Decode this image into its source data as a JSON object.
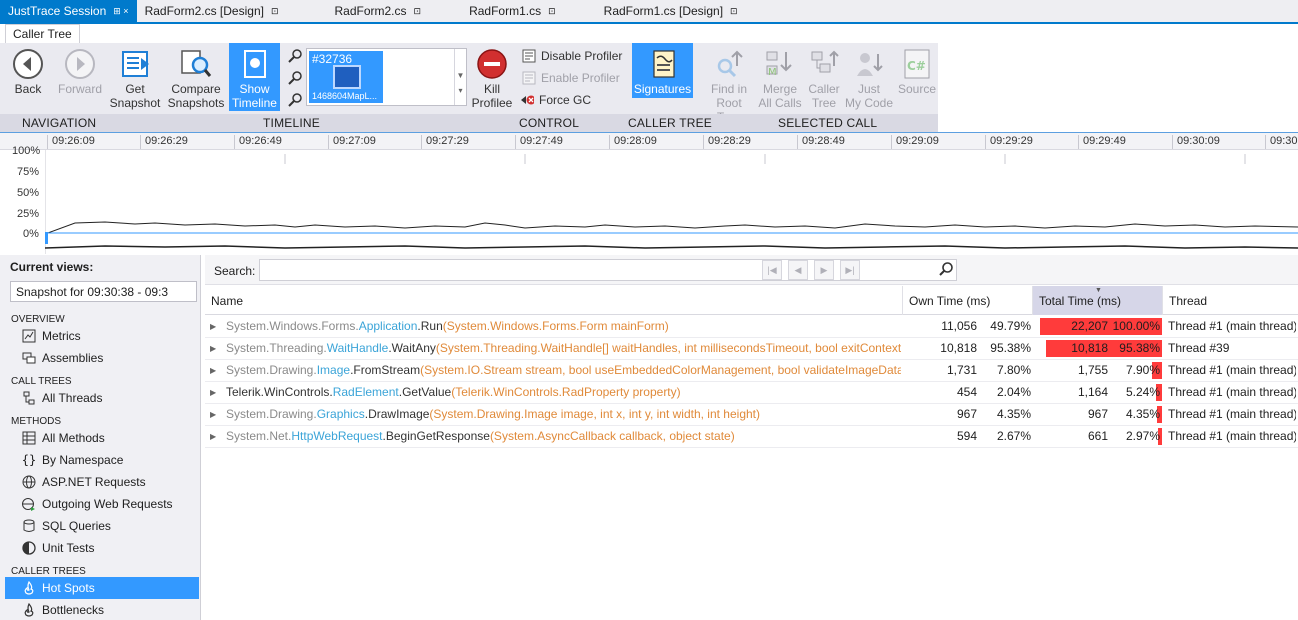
{
  "doc_tabs": [
    {
      "label": "JustTrace Session",
      "glyph": "⊞ ×",
      "active": true
    },
    {
      "label": "RadForm2.cs [Design]",
      "glyph": "⊡",
      "active": false
    },
    {
      "label": "RadForm2.cs",
      "glyph": "⊡",
      "active": false
    },
    {
      "label": "RadForm1.cs",
      "glyph": "⊡",
      "active": false
    },
    {
      "label": "RadForm1.cs [Design]",
      "glyph": "⊡",
      "active": false
    }
  ],
  "ribbon": {
    "tab": "Caller Tree",
    "buttons": {
      "back": "Back",
      "forward": "Forward",
      "get_snapshot_1": "Get",
      "get_snapshot_2": "Snapshot",
      "compare_1": "Compare",
      "compare_2": "Snapshots",
      "show_timeline_1": "Show",
      "show_timeline_2": "Timeline",
      "kill_1": "Kill",
      "kill_2": "Profilee",
      "signatures": "Signatures",
      "find_root_1": "Find in",
      "find_root_2": "Root Tree",
      "merge_1": "Merge",
      "merge_2": "All Calls",
      "caller_tree_1": "Caller",
      "caller_tree_2": "Tree",
      "just_my_code_1": "Just",
      "just_my_code_2": "My Code",
      "source": "Source"
    },
    "small_buttons": {
      "disable_profiler": "Disable Profiler",
      "enable_profiler": "Enable Profiler",
      "force_gc": "Force GC"
    },
    "snapshot": {
      "id": "#32736",
      "name": "1468604MapL..."
    },
    "groups": [
      "NAVIGATION",
      "TIMELINE",
      "CONTROL",
      "CALLER TREE",
      "SELECTED CALL"
    ]
  },
  "timeline": {
    "ticks": [
      "09:26:09",
      "09:26:29",
      "09:26:49",
      "09:27:09",
      "09:27:29",
      "09:27:49",
      "09:28:09",
      "09:28:29",
      "09:28:49",
      "09:29:09",
      "09:29:29",
      "09:29:49",
      "09:30:09",
      "09:30"
    ],
    "y_labels": [
      "100%",
      "75%",
      "50%",
      "25%",
      "0%"
    ]
  },
  "left_panel": {
    "current_views_label": "Current views:",
    "selected_view": "Snapshot for 09:30:38 - 09:3",
    "sections": {
      "overview": "OVERVIEW",
      "call_trees": "CALL TREES",
      "methods": "METHODS",
      "caller_trees": "CALLER TREES"
    },
    "items": {
      "metrics": "Metrics",
      "assemblies": "Assemblies",
      "all_threads": "All Threads",
      "all_methods": "All Methods",
      "by_namespace": "By Namespace",
      "aspnet": "ASP.NET Requests",
      "outgoing_web": "Outgoing Web Requests",
      "sql": "SQL Queries",
      "unit_tests": "Unit Tests",
      "hot_spots": "Hot Spots",
      "bottlenecks": "Bottlenecks"
    }
  },
  "grid": {
    "search_label": "Search:",
    "search_value": "",
    "columns": {
      "name": "Name",
      "own_time": "Own Time (ms)",
      "total_time": "Total Time (ms)",
      "thread": "Thread"
    },
    "rows": [
      {
        "ns": "System.Windows.Forms.",
        "cls": "Application",
        "method": ".Run",
        "sig": "(System.Windows.Forms.Form mainForm)",
        "ns_dark": false,
        "own": "11,056",
        "own_pct": "49.79%",
        "total": "22,207",
        "total_pct": "100.00%",
        "total_frac": 1.0,
        "thread": "Thread #1 (main thread)"
      },
      {
        "ns": "System.Threading.",
        "cls": "WaitHandle",
        "method": ".WaitAny",
        "sig": "(System.Threading.WaitHandle[] waitHandles, int millisecondsTimeout, bool exitContext",
        "ns_dark": false,
        "own": "10,818",
        "own_pct": "95.38%",
        "total": "10,818",
        "total_pct": "95.38%",
        "total_frac": 0.9538,
        "thread": "Thread #39"
      },
      {
        "ns": "System.Drawing.",
        "cls": "Image",
        "method": ".FromStream",
        "sig": "(System.IO.Stream stream, bool useEmbeddedColorManagement, bool validateImageData)",
        "ns_dark": false,
        "own": "1,731",
        "own_pct": "7.80%",
        "total": "1,755",
        "total_pct": "7.90%",
        "total_frac": 0.079,
        "thread": "Thread #1 (main thread)"
      },
      {
        "ns": "Telerik.WinControls.",
        "cls": "RadElement",
        "method": ".GetValue",
        "sig": "(Telerik.WinControls.RadProperty property)",
        "ns_dark": true,
        "own": "454",
        "own_pct": "2.04%",
        "total": "1,164",
        "total_pct": "5.24%",
        "total_frac": 0.0524,
        "thread": "Thread #1 (main thread)"
      },
      {
        "ns": "System.Drawing.",
        "cls": "Graphics",
        "method": ".DrawImage",
        "sig": "(System.Drawing.Image image, int x, int y, int width, int height)",
        "ns_dark": false,
        "own": "967",
        "own_pct": "4.35%",
        "total": "967",
        "total_pct": "4.35%",
        "total_frac": 0.0435,
        "thread": "Thread #1 (main thread)"
      },
      {
        "ns": "System.Net.",
        "cls": "HttpWebRequest",
        "method": ".BeginGetResponse",
        "sig": "(System.AsyncCallback callback, object state)",
        "ns_dark": false,
        "own": "594",
        "own_pct": "2.67%",
        "total": "661",
        "total_pct": "2.97%",
        "total_frac": 0.0297,
        "thread": "Thread #1 (main thread)"
      }
    ]
  }
}
